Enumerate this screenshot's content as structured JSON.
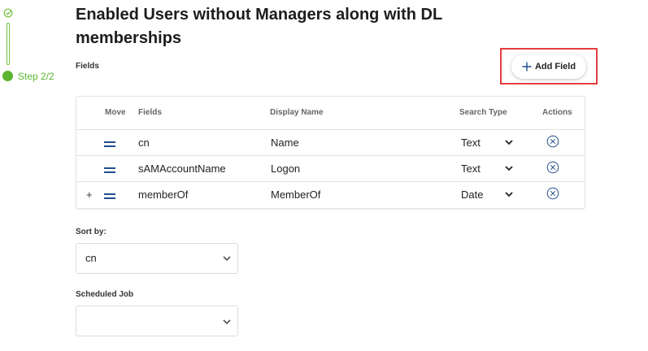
{
  "stepper": {
    "label": "Step 2/2"
  },
  "page": {
    "title": "Enabled Users without Managers along with DL memberships"
  },
  "fields_section": {
    "label": "Fields",
    "add_button_label": "Add Field"
  },
  "table": {
    "headers": {
      "move": "Move",
      "fields": "Fields",
      "display_name": "Display Name",
      "search_type": "Search Type",
      "actions": "Actions"
    },
    "rows": [
      {
        "field": "cn",
        "display_name": "Name",
        "search_type": "Text",
        "expand": ""
      },
      {
        "field": "sAMAccountName",
        "display_name": "Logon",
        "search_type": "Text",
        "expand": ""
      },
      {
        "field": "memberOf",
        "display_name": "MemberOf",
        "search_type": "Date",
        "expand": "+"
      }
    ]
  },
  "sort_by": {
    "label": "Sort by:",
    "value": "cn"
  },
  "scheduled_job": {
    "label": "Scheduled Job",
    "value": ""
  },
  "colors": {
    "step_green": "#5cb531",
    "highlight_red": "#e53e3e",
    "accent_blue": "#1f4e8c"
  },
  "icons": {
    "step_done": "check-circle-icon",
    "add": "plus-icon",
    "drag": "drag-handle-icon",
    "dropdown": "chevron-down-icon",
    "remove": "remove-circle-icon"
  }
}
